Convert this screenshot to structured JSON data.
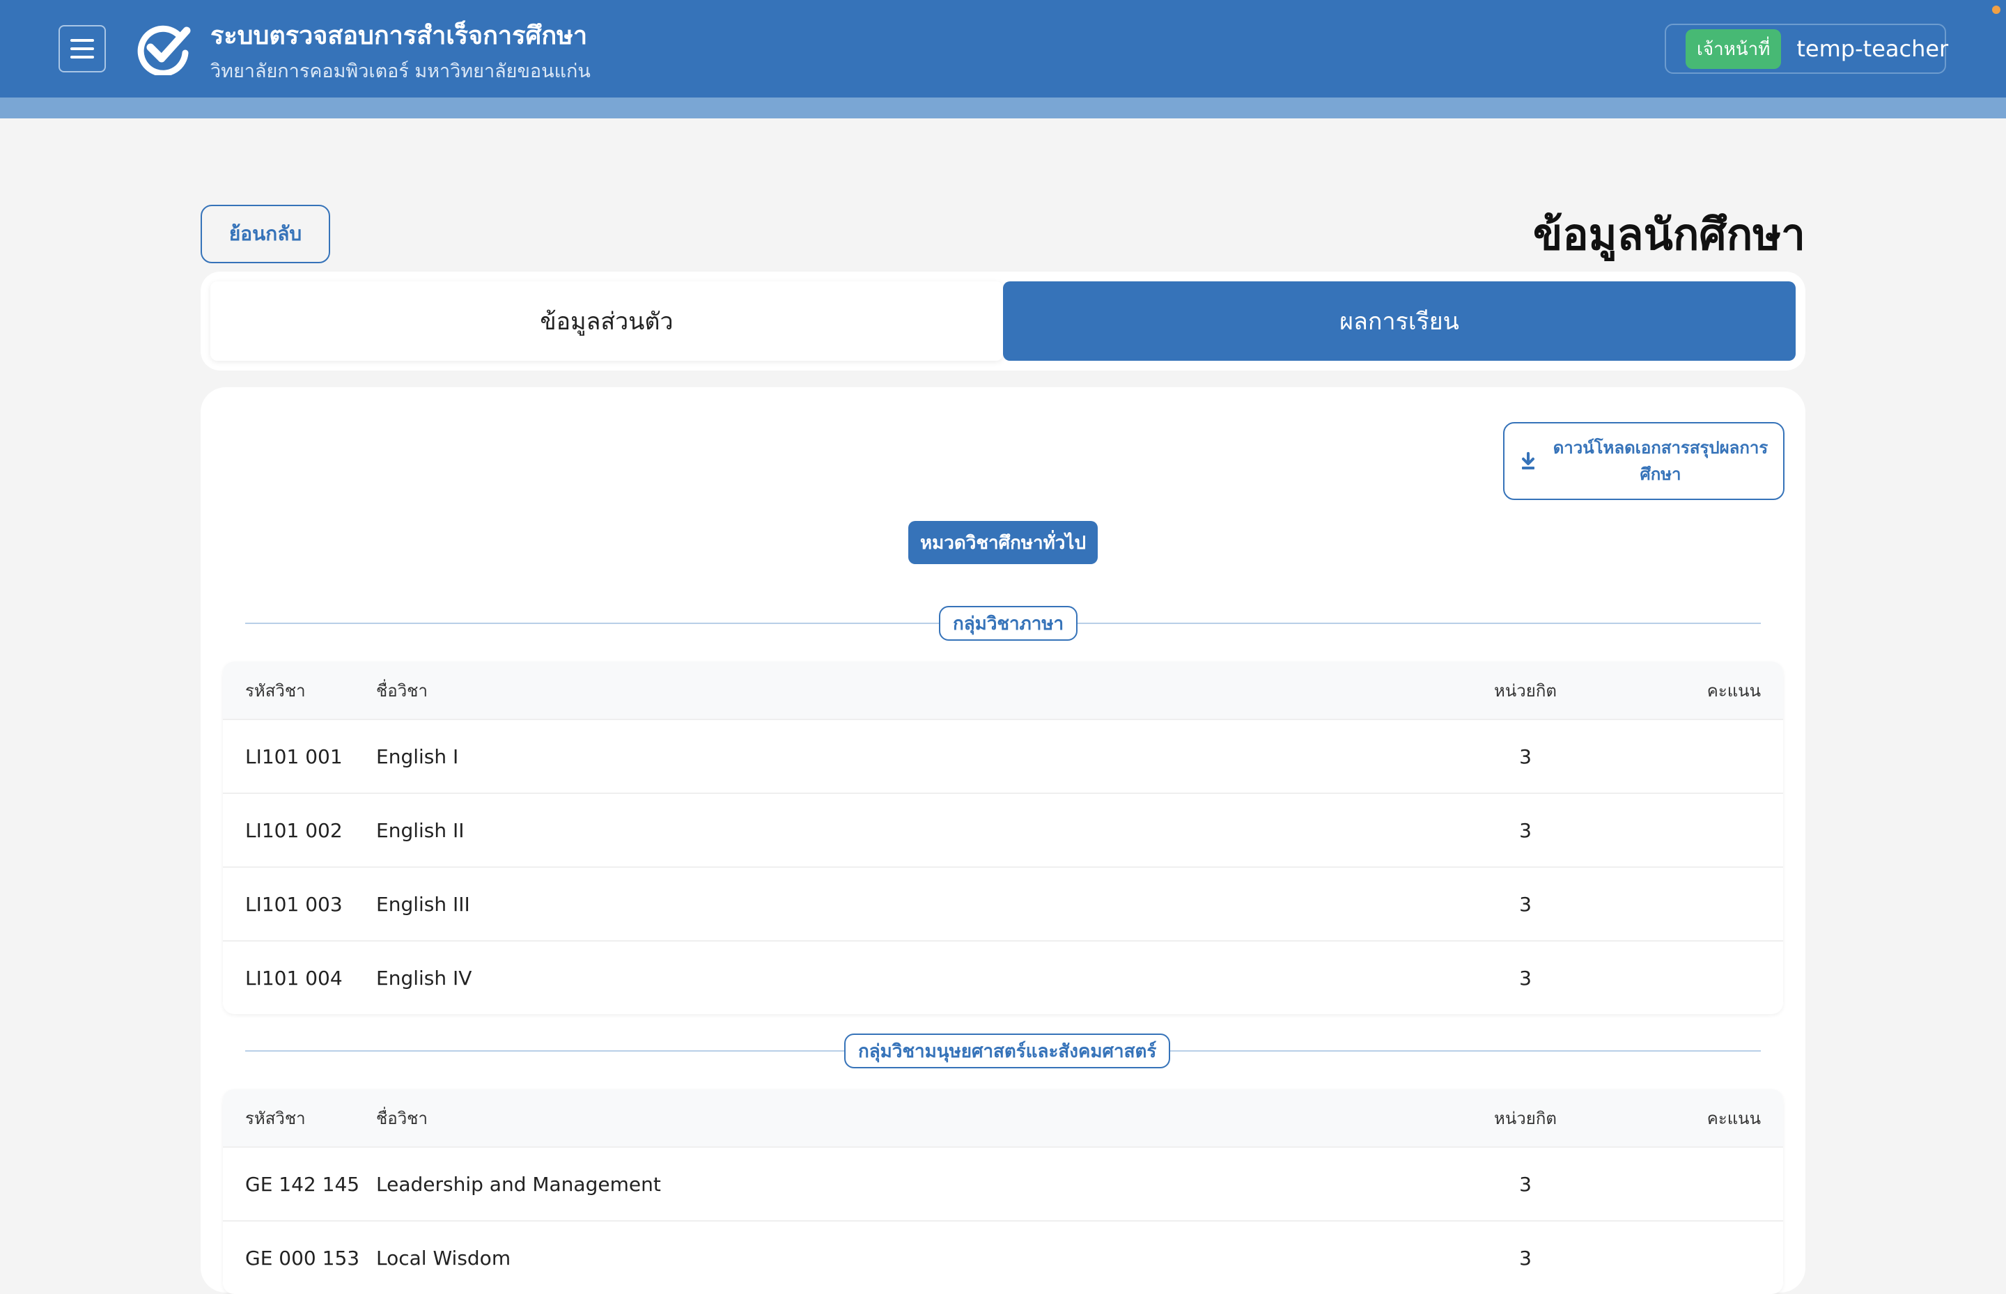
{
  "header": {
    "title": "ระบบตรวจสอบการสำเร็จการศึกษา",
    "subtitle": "วิทยาลัยการคอมพิวเตอร์ มหาวิทยาลัยขอนแก่น",
    "role_badge": "เจ้าหน้าที่",
    "username": "temp-teacher"
  },
  "page": {
    "back_label": "ย้อนกลับ",
    "title": "ข้อมูลนักศึกษา"
  },
  "tabs": [
    {
      "label": "ข้อมูลส่วนตัว",
      "active": false
    },
    {
      "label": "ผลการเรียน",
      "active": true
    }
  ],
  "results": {
    "download_label": "ดาวน์โหลดเอกสารสรุปผลการศึกษา",
    "category": "หมวดวิชาศึกษาทั่วไป",
    "columns": {
      "code": "รหัสวิชา",
      "name": "ชื่อวิชา",
      "credit": "หน่วยกิต",
      "score": "คะแนน"
    },
    "groups": [
      {
        "label": "กลุ่มวิชาภาษา",
        "rows": [
          {
            "code": "LI101 001",
            "name": "English I",
            "credit": "3",
            "score": ""
          },
          {
            "code": "LI101 002",
            "name": "English II",
            "credit": "3",
            "score": ""
          },
          {
            "code": "LI101 003",
            "name": "English III",
            "credit": "3",
            "score": ""
          },
          {
            "code": "LI101 004",
            "name": "English IV",
            "credit": "3",
            "score": ""
          }
        ]
      },
      {
        "label": "กลุ่มวิชามนุษยศาสตร์และสังคมศาสตร์",
        "rows": [
          {
            "code": "GE 142 145",
            "name": "Leadership and Management",
            "credit": "3",
            "score": ""
          },
          {
            "code": "GE 000 153",
            "name": "Local Wisdom",
            "credit": "3",
            "score": ""
          }
        ]
      }
    ]
  },
  "colors": {
    "primary": "#3673b9",
    "badge_green": "#47b974",
    "background": "#f4f4f4"
  },
  "icons": {
    "menu": "hamburger-icon",
    "logo": "check-circle-icon",
    "download": "download-icon"
  }
}
